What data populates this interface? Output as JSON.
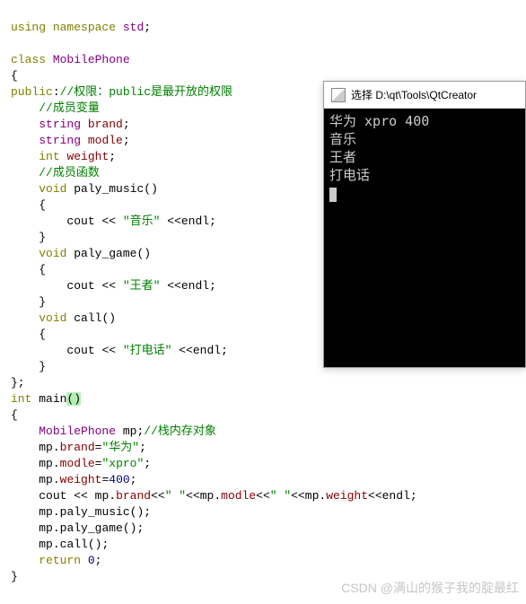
{
  "code": {
    "l1": {
      "using": "using",
      "namespace": "namespace",
      "std": "std",
      "semi": ";"
    },
    "l2": "",
    "l3": {
      "class": "class",
      "name": "MobilePhone"
    },
    "l4": "{",
    "l5": {
      "public": "public",
      "colon": ":",
      "comment": "//权限：public是最开放的权限"
    },
    "l6": {
      "comment": "//成员变量"
    },
    "l7": {
      "type": "string",
      "name": "brand",
      "semi": ";"
    },
    "l8": {
      "type": "string",
      "name": "modle",
      "semi": ";"
    },
    "l9": {
      "type": "int",
      "name": "weight",
      "semi": ";"
    },
    "l10": {
      "comment": "//成员函数"
    },
    "l11": {
      "type": "void",
      "name": "paly_music",
      "parens": "()"
    },
    "l12": "{",
    "l13": {
      "cout": "cout",
      "op1": " << ",
      "str": "\"音乐\"",
      "op2": " <<",
      "endl": "endl",
      "semi": ";"
    },
    "l14": "}",
    "l15": {
      "type": "void",
      "name": "paly_game",
      "parens": "()"
    },
    "l16": "{",
    "l17": {
      "cout": "cout",
      "op1": " << ",
      "str": "\"王者\"",
      "op2": " <<",
      "endl": "endl",
      "semi": ";"
    },
    "l18": "}",
    "l19": {
      "type": "void",
      "name": "call",
      "parens": "()"
    },
    "l20": "{",
    "l21": {
      "cout": "cout",
      "op1": " << ",
      "str": "\"打电话\"",
      "op2": " <<",
      "endl": "endl",
      "semi": ";"
    },
    "l22": "}",
    "l23": "};",
    "l24": {
      "type": "int",
      "name": "main",
      "parens": "()"
    },
    "l25": "{",
    "l26": {
      "type": "MobilePhone",
      "name": "mp",
      "semi": ";",
      "comment": "//栈内存对象"
    },
    "l27": {
      "obj": "mp",
      "dot": ".",
      "mem": "brand",
      "eq": "=",
      "val": "\"华为\"",
      "semi": ";"
    },
    "l28": {
      "obj": "mp",
      "dot": ".",
      "mem": "modle",
      "eq": "=",
      "val": "\"xpro\"",
      "semi": ";"
    },
    "l29": {
      "obj": "mp",
      "dot": ".",
      "mem": "weight",
      "eq": "=",
      "val": "400",
      "semi": ";"
    },
    "l30": {
      "cout": "cout",
      "op": " << ",
      "a": "mp",
      "d": ".",
      "b": "brand",
      "op2": "<<",
      "sp": "\" \"",
      "op3": "<<",
      "a2": "mp",
      "d2": ".",
      "b2": "modle",
      "op4": "<<",
      "sp2": "\" \"",
      "op5": "<<",
      "a3": "mp",
      "d3": ".",
      "b3": "weight",
      "op6": "<<",
      "endl": "endl",
      "semi": ";"
    },
    "l31": {
      "obj": "mp",
      "dot": ".",
      "fn": "paly_music",
      "call": "();"
    },
    "l32": {
      "obj": "mp",
      "dot": ".",
      "fn": "paly_game",
      "call": "();"
    },
    "l33": {
      "obj": "mp",
      "dot": ".",
      "fn": "call",
      "call": "();"
    },
    "l34": {
      "return": "return",
      "val": "0",
      "semi": ";"
    },
    "l35": "}"
  },
  "terminal": {
    "title": "选择 D:\\qt\\Tools\\QtCreator",
    "line1": "华为 xpro 400",
    "line2": "音乐",
    "line3": "王者",
    "line4": "打电话"
  },
  "watermark": "CSDN @满山的猴子我的腚最红"
}
